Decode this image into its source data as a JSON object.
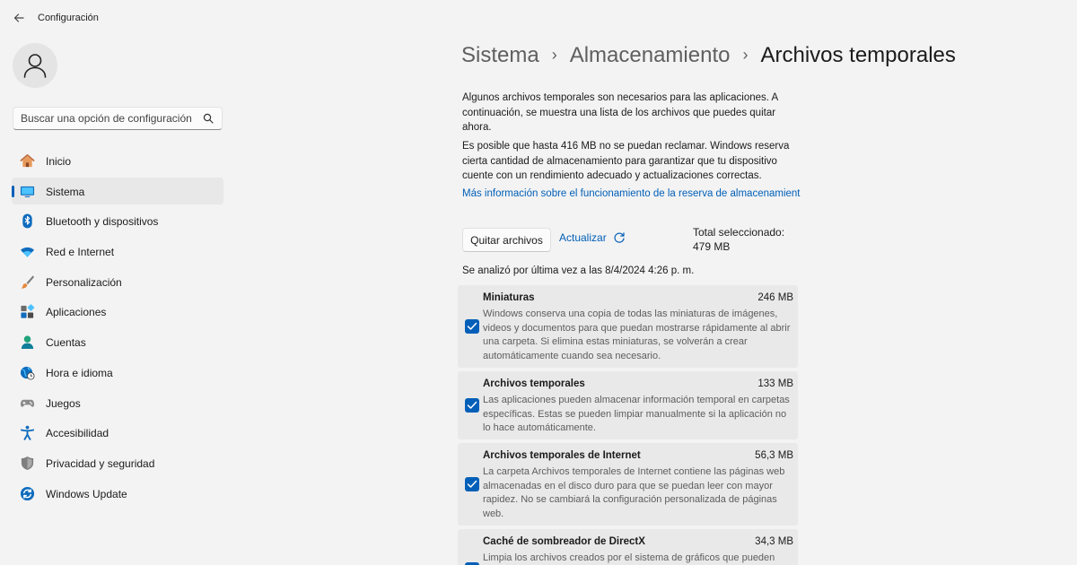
{
  "window": {
    "title": "Configuración"
  },
  "search": {
    "placeholder": "Buscar una opción de configuración"
  },
  "nav": {
    "items": [
      {
        "label": "Inicio"
      },
      {
        "label": "Sistema"
      },
      {
        "label": "Bluetooth y dispositivos"
      },
      {
        "label": "Red e Internet"
      },
      {
        "label": "Personalización"
      },
      {
        "label": "Aplicaciones"
      },
      {
        "label": "Cuentas"
      },
      {
        "label": "Hora e idioma"
      },
      {
        "label": "Juegos"
      },
      {
        "label": "Accesibilidad"
      },
      {
        "label": "Privacidad y seguridad"
      },
      {
        "label": "Windows Update"
      }
    ]
  },
  "breadcrumb": {
    "level1": "Sistema",
    "level2": "Almacenamiento",
    "current": "Archivos temporales"
  },
  "content": {
    "intro": "Algunos archivos temporales son necesarios para las aplicaciones. A continuación, se muestra una lista de los archivos que puedes quitar ahora.",
    "reserve": "Es posible que hasta 416 MB no se puedan reclamar. Windows reserva cierta cantidad de almacenamiento para garantizar que tu dispositivo cuente con un rendimiento adecuado y actualizaciones correctas.",
    "link": "Más información sobre el funcionamiento de la reserva de almacenamiento",
    "remove_label": "Quitar archivos",
    "refresh_label": "Actualizar",
    "total_selected": "Total seleccionado: 479 MB",
    "last_scan": "Se analizó por última vez a las 8/4/2024 4:26 p. m."
  },
  "files": [
    {
      "title": "Miniaturas",
      "size": "246 MB",
      "checked": true,
      "description": "Windows conserva una copia de todas las miniaturas de imágenes, videos y documentos para que puedan mostrarse rápidamente al abrir una carpeta. Si elimina estas miniaturas, se volverán a crear automáticamente cuando sea necesario."
    },
    {
      "title": "Archivos temporales",
      "size": "133 MB",
      "checked": true,
      "description": "Las aplicaciones pueden almacenar información temporal en carpetas específicas. Estas se pueden limpiar manualmente si la aplicación no lo hace automáticamente."
    },
    {
      "title": "Archivos temporales de Internet",
      "size": "56,3 MB",
      "checked": true,
      "description": "La carpeta Archivos temporales de Internet contiene las páginas web almacenadas en el disco duro para que se puedan leer con mayor rapidez. No se cambiará la configuración personalizada de páginas web."
    },
    {
      "title": "Caché de sombreador de DirectX",
      "size": "34,3 MB",
      "checked": true,
      "description": "Limpia los archivos creados por el sistema de gráficos que pueden"
    }
  ],
  "theme": {
    "accent": "#005fb8",
    "background": "#f3f3f3",
    "card": "#e9e9e9"
  },
  "icons": {
    "back": "back-arrow-icon",
    "avatar": "user-icon",
    "search": "search-icon",
    "nav": [
      "home-icon",
      "monitor-icon",
      "bluetooth-icon",
      "wifi-icon",
      "paintbrush-icon",
      "apps-icon",
      "accounts-icon",
      "globe-clock-icon",
      "gamepad-icon",
      "accessibility-icon",
      "shield-icon",
      "windows-update-icon"
    ]
  }
}
